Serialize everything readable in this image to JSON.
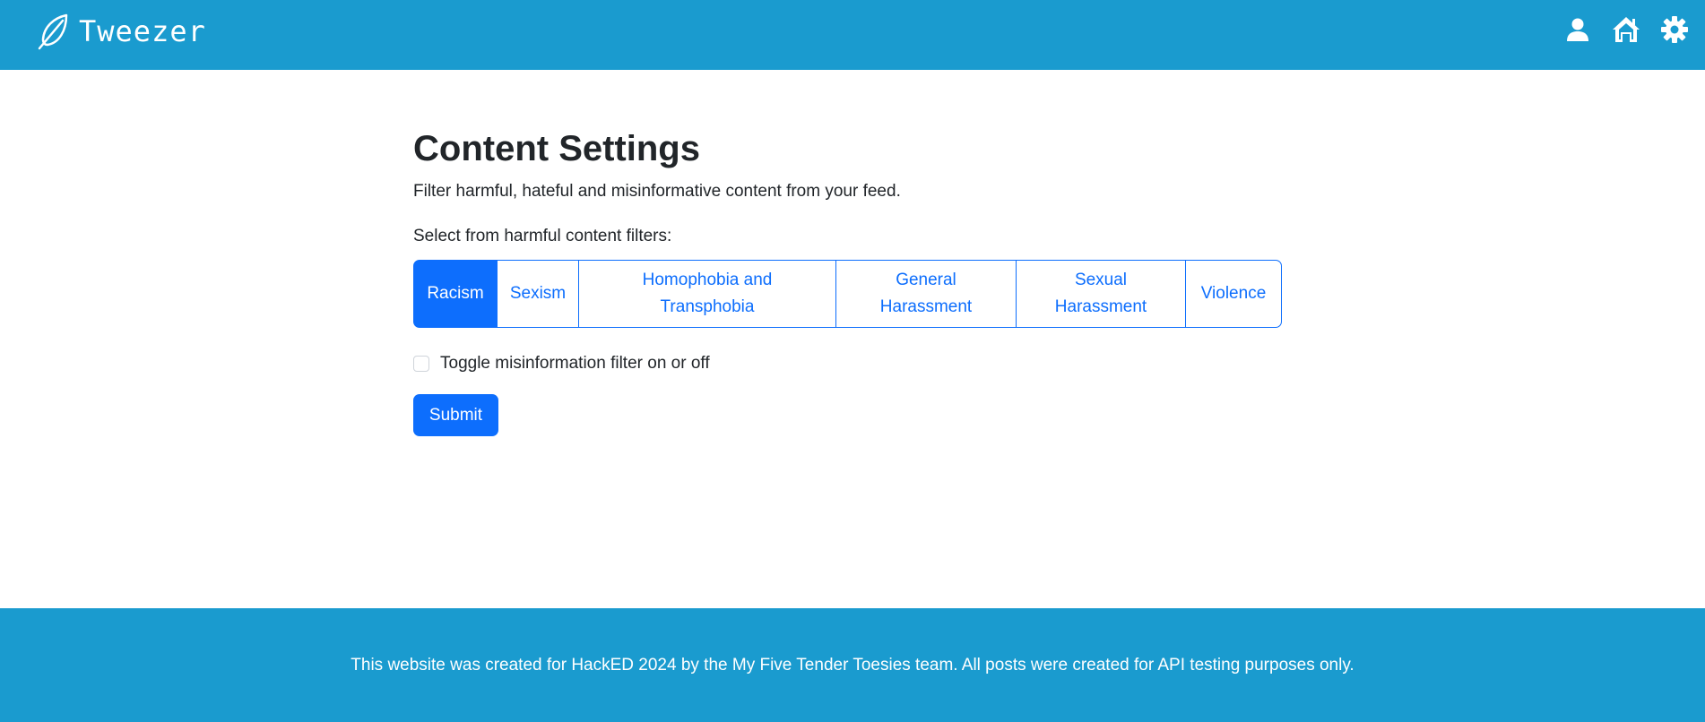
{
  "header": {
    "brand_name": "Tweezer",
    "brand_icon": "feather-icon",
    "nav_icons": [
      "user-icon",
      "home-icon",
      "gear-icon"
    ],
    "background_color": "#1a9bcf"
  },
  "main": {
    "title": "Content Settings",
    "subtitle": "Filter harmful, hateful and misinformative content from your feed.",
    "filters_label": "Select from harmful content filters:",
    "filters": [
      {
        "label": "Racism",
        "active": true
      },
      {
        "label": "Sexism",
        "active": false
      },
      {
        "label": "Homophobia and Transphobia",
        "active": false
      },
      {
        "label": "General Harassment",
        "active": false
      },
      {
        "label": "Sexual Harassment",
        "active": false
      },
      {
        "label": "Violence",
        "active": false
      }
    ],
    "misinfo_toggle": {
      "label": "Toggle misinformation filter on or off",
      "checked": false
    },
    "submit_label": "Submit",
    "accent_color": "#0d6efd"
  },
  "footer": {
    "text": "This website was created for HackED 2024 by the My Five Tender Toesies team. All posts were created for API testing purposes only."
  }
}
